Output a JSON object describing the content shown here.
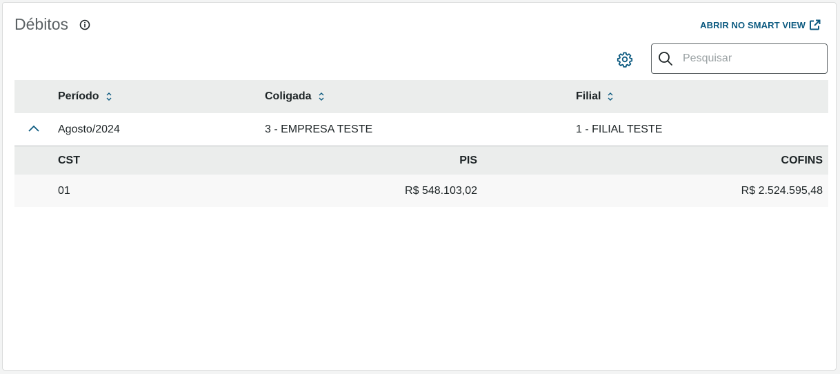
{
  "header": {
    "title": "Débitos",
    "smart_view_link": "ABRIR NO SMART VIEW"
  },
  "search": {
    "placeholder": "Pesquisar",
    "value": ""
  },
  "table": {
    "columns": [
      "Período",
      "Coligada",
      "Filial"
    ],
    "rows": [
      {
        "periodo": "Agosto/2024",
        "coligada": "3 - EMPRESA TESTE",
        "filial": "1 - FILIAL TESTE",
        "expanded": true,
        "detail": {
          "columns": [
            "CST",
            "PIS",
            "COFINS"
          ],
          "rows": [
            {
              "cst": "01",
              "pis": "R$ 548.103,02",
              "cofins": "R$ 2.524.595,48"
            }
          ]
        }
      }
    ]
  },
  "colors": {
    "accent": "#0c5a80",
    "header_bg": "#ebedec",
    "text": "#1d2426",
    "title": "#5b6164"
  },
  "icons": {
    "info": "info-icon",
    "external": "external-link-icon",
    "settings": "gear-icon",
    "search": "search-icon",
    "sort": "sort-icon",
    "collapse": "chevron-up-icon"
  }
}
